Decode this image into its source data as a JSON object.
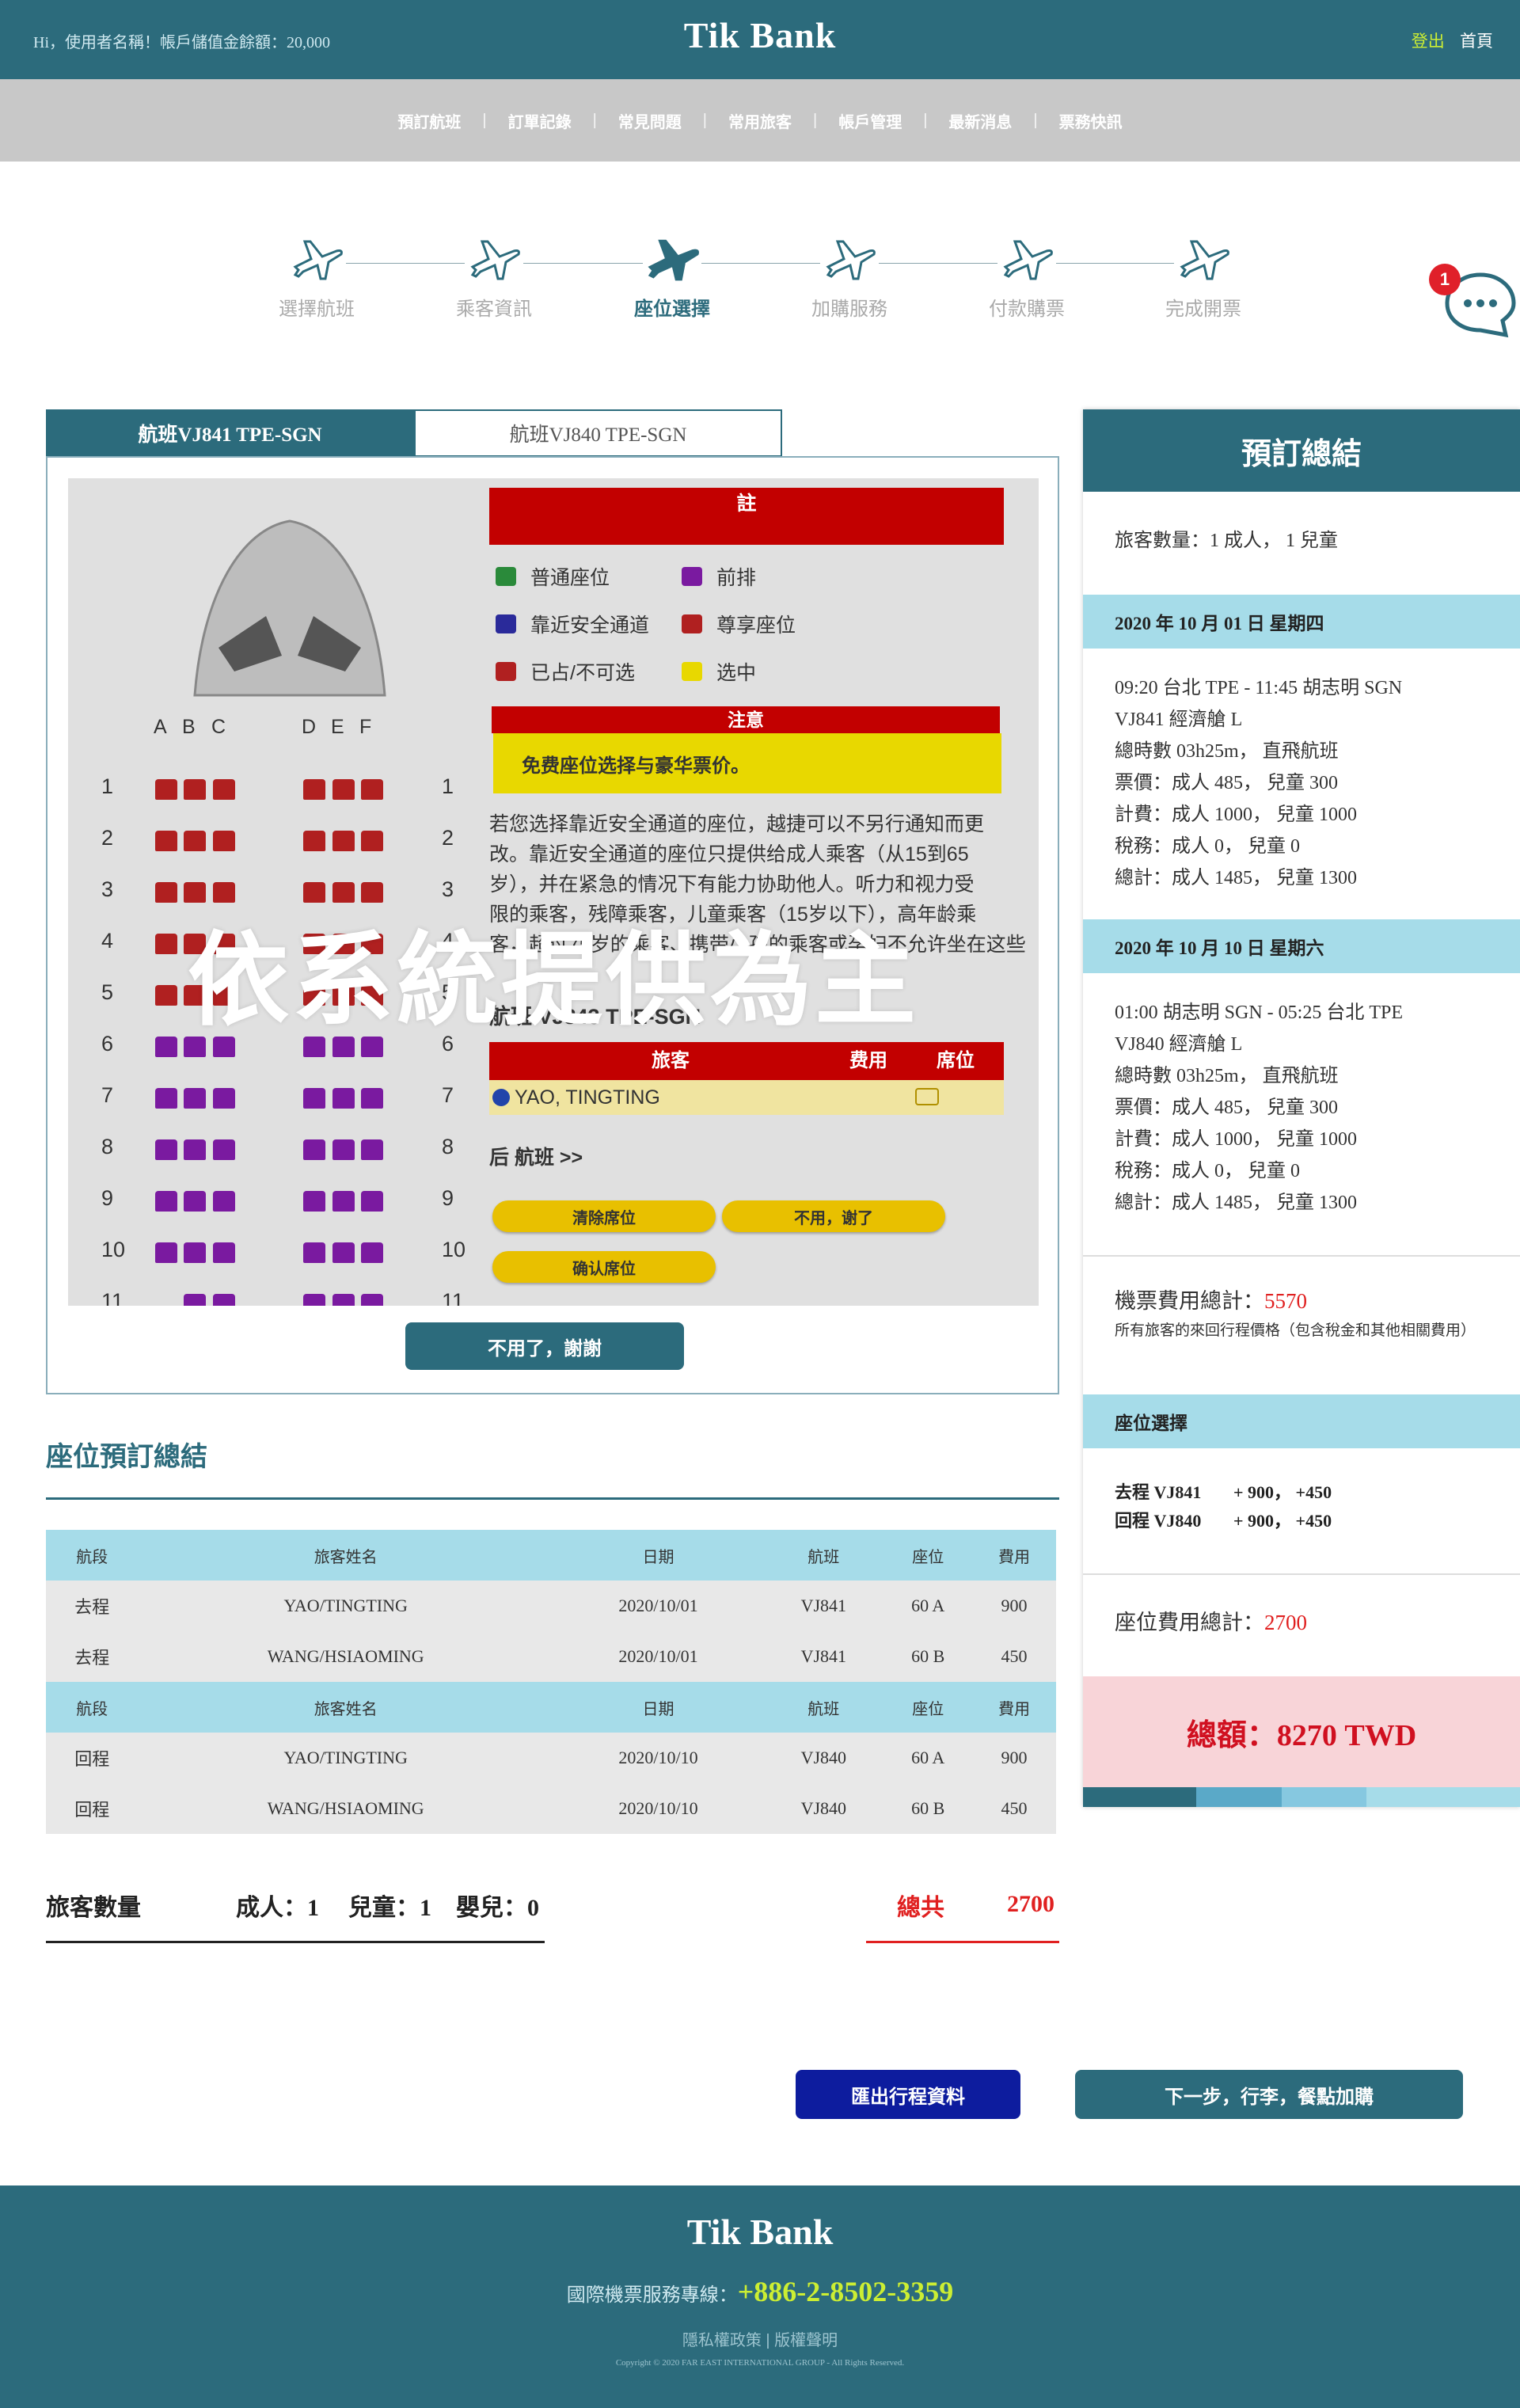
{
  "header": {
    "greeting": "Hi，使用者名稱！帳戶儲值金餘額：20,000",
    "brand": "Tik Bank",
    "logout": "登出",
    "home": "首頁"
  },
  "nav": [
    "預訂航班",
    "訂單記錄",
    "常見問題",
    "常用旅客",
    "帳戶管理",
    "最新消息",
    "票務快訊"
  ],
  "steps": [
    "選擇航班",
    "乘客資訊",
    "座位選擇",
    "加購服務",
    "付款購票",
    "完成開票"
  ],
  "active_step": "座位選擇",
  "chat_badge": "1",
  "tabs": [
    "航班VJ841 TPE-SGN",
    "航班VJ840 TPE-SGN"
  ],
  "seatmap": {
    "legend_title": "註",
    "legend": [
      "普通座位",
      "前排",
      "靠近安全通道",
      "尊享座位",
      "已占/不可选",
      "选中"
    ],
    "notice_title": "注意",
    "notice": "免费座位选择与豪华票价。",
    "note_lines": [
      "若您选择靠近安全通道的座位，越捷可以不另行通知而更",
      "改。靠近安全通道的座位只提供给成人乘客（从15到65",
      "岁），并在紧急的情况下有能力协助他人。听力和视力受",
      "限的乘客，残障乘客，儿童乘客（15岁以下），高年龄乘",
      "客，超过75岁的乘客、携带小孩的乘客或孕妇不允许坐在这些"
    ],
    "flight": "航班 VJ843 TPE-SGN",
    "pax_header": [
      "旅客",
      "费用",
      "席位"
    ],
    "pax_row": "YAO, TINGTING",
    "next_flight": "后 航班 >>",
    "btn_clear": "清除席位",
    "btn_nothanks_cn": "不用，谢了",
    "btn_confirm": "确认席位",
    "cols": [
      "A",
      "B",
      "C",
      "D",
      "E",
      "F"
    ],
    "rows": [
      "1",
      "2",
      "3",
      "4",
      "5",
      "6",
      "7",
      "8",
      "9",
      "10",
      "11"
    ],
    "overlay": "依系統提供為主"
  },
  "no_thanks": "不用了，謝謝",
  "summary": {
    "title": "座位預訂總結",
    "headers": [
      "航段",
      "旅客姓名",
      "日期",
      "航班",
      "座位",
      "費用"
    ],
    "outbound": [
      [
        "去程",
        "YAO/TINGTING",
        "2020/10/01",
        "VJ841",
        "60 A",
        "900"
      ],
      [
        "去程",
        "WANG/HSIAOMING",
        "2020/10/01",
        "VJ841",
        "60 B",
        "450"
      ]
    ],
    "inbound": [
      [
        "回程",
        "YAO/TINGTING",
        "2020/10/10",
        "VJ840",
        "60 A",
        "900"
      ],
      [
        "回程",
        "WANG/HSIAOMING",
        "2020/10/10",
        "VJ840",
        "60 B",
        "450"
      ]
    ],
    "pax_label": "旅客數量",
    "adult": "成人：1",
    "child": "兒童：1",
    "infant": "嬰兒：0",
    "total_label": "總共",
    "total_value": "2700"
  },
  "buttons": {
    "export": "匯出行程資料",
    "next": "下一步，行李，餐點加購"
  },
  "side": {
    "title": "預訂總結",
    "pax": "旅客數量：1 成人， 1 兒童",
    "date1": "2020 年 10 月 01 日 星期四",
    "trip1": [
      "09:20 台北 TPE - 11:45 胡志明 SGN",
      "VJ841 經濟艙 L",
      "總時數 03h25m， 直飛航班",
      "票價：成人 485， 兒童 300",
      "計費：成人 1000， 兒童 1000",
      "稅務：成人 0， 兒童 0",
      "總計：成人 1485， 兒童 1300"
    ],
    "date2": "2020 年 10 月 10 日 星期六",
    "trip2": [
      "01:00 胡志明 SGN - 05:25 台北 TPE",
      "VJ840 經濟艙 L",
      "總時數 03h25m， 直飛航班",
      "票價：成人 485， 兒童 300",
      "計費：成人 1000， 兒童 1000",
      "稅務：成人 0， 兒童 0",
      "總計：成人 1485， 兒童 1300"
    ],
    "fare_total_label": "機票費用總計：",
    "fare_total": "5570",
    "fare_note": "所有旅客的來回行程價格（包含稅金和其他相關費用）",
    "seat_band": "座位選擇",
    "seat_out_label": "去程 VJ841",
    "seat_out_val": "+ 900， +450",
    "seat_in_label": "回程 VJ840",
    "seat_in_val": "+ 900， +450",
    "seat_total_label": "座位費用總計：",
    "seat_total": "2700",
    "grand": "總額：8270 TWD"
  },
  "footer": {
    "brand": "Tik Bank",
    "hotline_label": "國際機票服務專線：",
    "hotline": "+886-2-8502-3359",
    "links": [
      "隱私權政策",
      "版權聲明"
    ],
    "copyright": "Copyright © 2020 FAR EAST INTERNATIONAL GROUP - All Rights Reserved."
  },
  "colors": {
    "primary": "#2c6b7c",
    "light": "#a6dce9",
    "accent_red": "#e02020",
    "highlight": "#ccee33"
  }
}
